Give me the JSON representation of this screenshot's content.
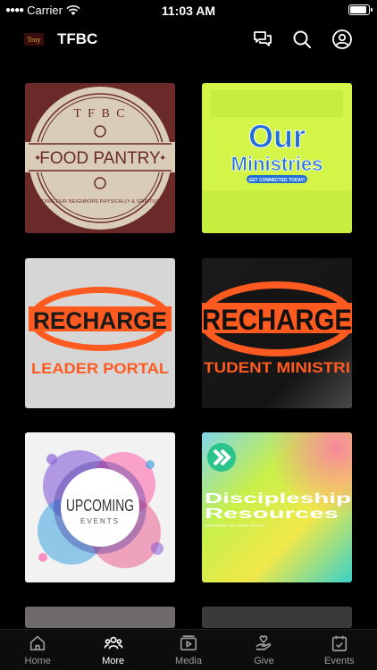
{
  "status_bar": {
    "carrier": "Carrier",
    "time": "11:03 AM",
    "battery_level": 0.95
  },
  "header": {
    "logo_text": "Troy",
    "title": "TFBC"
  },
  "tiles": {
    "food_pantry": {
      "arc_top": "T F B C",
      "title": "FOOD PANTRY",
      "arc_bottom": "FEEDING OUR NEIGHBORS PHYSICALLY & SPIRITUALLY"
    },
    "our_ministries": {
      "line1": "Our",
      "line2": "Ministries",
      "badge": "GET CONNECTED TODAY!"
    },
    "recharge_leader": {
      "title": "RECHARGE",
      "subtitle": "LEADER PORTAL"
    },
    "recharge_student": {
      "title": "RECHARGE",
      "subtitle": "TUDENT MINISTRI"
    },
    "upcoming_events": {
      "title": "UPCOMING",
      "subtitle": "EVENTS"
    },
    "discipleship": {
      "line1": "Discipleship",
      "line2": "Resources",
      "tagline": "GROWING IN YOUR FAITH"
    }
  },
  "tabs": [
    {
      "label": "Home",
      "icon": "home-icon"
    },
    {
      "label": "More",
      "icon": "people-icon"
    },
    {
      "label": "Media",
      "icon": "media-icon"
    },
    {
      "label": "Give",
      "icon": "give-icon"
    },
    {
      "label": "Events",
      "icon": "calendar-icon"
    }
  ],
  "colors": {
    "background": "#000000",
    "pantry_brown": "#6b2a2a",
    "ministries_lime": "#d3f548",
    "ministries_blue": "#1f6fd6",
    "recharge_orange": "#ff5a1f",
    "active_tab": "#ffffff",
    "inactive_tab": "#9b9b9b"
  }
}
